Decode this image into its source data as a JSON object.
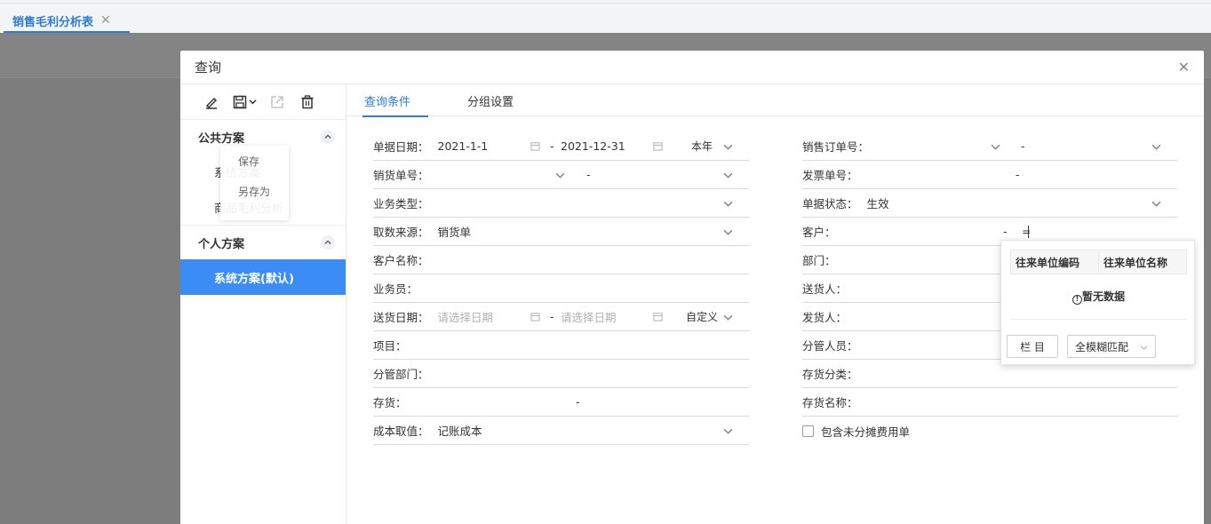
{
  "top_tab": {
    "label": "销售毛利分析表",
    "close": "✕"
  },
  "dialog": {
    "title": "查询",
    "close": "✕",
    "save_menu": {
      "save": "保存",
      "save_as": "另存为"
    },
    "groups": [
      {
        "title": "公共方案",
        "items": [
          "系统方案",
          "商品毛利分析"
        ]
      },
      {
        "title": "个人方案",
        "items": [
          "系统方案(默认)"
        ]
      }
    ],
    "tabs": [
      "查询条件",
      "分组设置"
    ],
    "left_fields": [
      {
        "label": "单据日期：",
        "from": "2021-1-1",
        "to": "2021-12-31",
        "range": "本年"
      },
      {
        "label": "销货单号：",
        "dash": "-"
      },
      {
        "label": "业务类型："
      },
      {
        "label": "取数来源：",
        "value": "销货单"
      },
      {
        "label": "客户名称："
      },
      {
        "label": "业务员："
      },
      {
        "label": "送货日期：",
        "from_ph": "请选择日期",
        "to_ph": "请选择日期",
        "range": "自定义"
      },
      {
        "label": "项目："
      },
      {
        "label": "分管部门："
      },
      {
        "label": "存货：",
        "dash": "-"
      },
      {
        "label": "成本取值：",
        "value": "记账成本"
      }
    ],
    "right_fields": [
      {
        "label": "销售订单号：",
        "dash": "-"
      },
      {
        "label": "发票单号：",
        "dash": "-"
      },
      {
        "label": "单据状态：",
        "value": "生效"
      },
      {
        "label": "客户：",
        "dash": "-",
        "input": "="
      },
      {
        "label": "部门："
      },
      {
        "label": "送货人："
      },
      {
        "label": "发货人："
      },
      {
        "label": "分管人员："
      },
      {
        "label": "存货分类："
      },
      {
        "label": "存货名称："
      }
    ],
    "checkbox_label": "包含未分摊费用单",
    "date_sep": "-"
  },
  "customer_popup": {
    "col1": "往来单位编码",
    "col2": "往来单位名称",
    "empty": "暂无数据",
    "columns_button": "栏 目",
    "match_select": "全模糊匹配"
  },
  "colors": {
    "accent": "#2d7cd6",
    "selected": "#3b8cf4"
  }
}
